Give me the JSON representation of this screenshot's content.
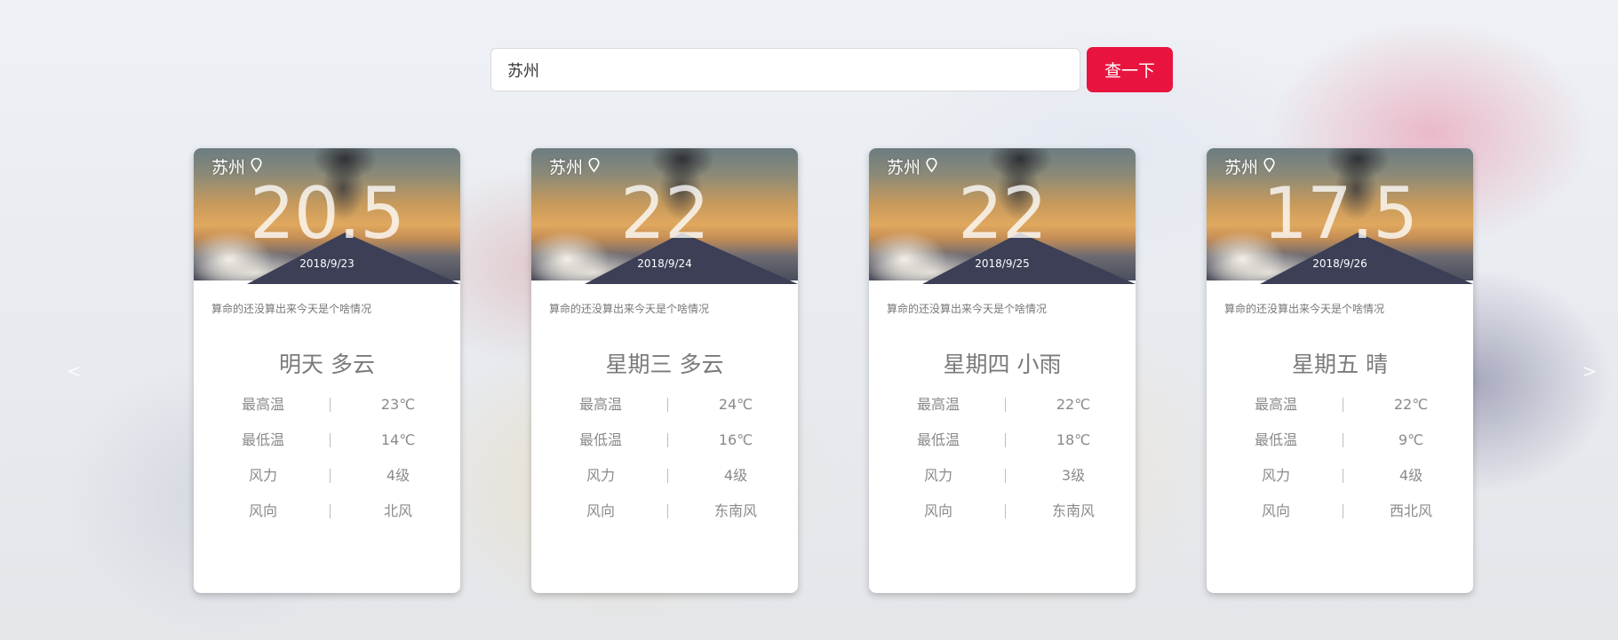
{
  "search": {
    "value": "苏州",
    "button_label": "查一下"
  },
  "carousel": {
    "prev_glyph": "<",
    "next_glyph": ">"
  },
  "cards": [
    {
      "city": "苏州",
      "temp": "20.5",
      "date": "2018/9/23",
      "note": "算命的还没算出来今天是个啥情况",
      "title": "明天 多云",
      "rows": [
        {
          "label": "最高温",
          "value": "23℃"
        },
        {
          "label": "最低温",
          "value": "14℃"
        },
        {
          "label": "风力",
          "value": "4级"
        },
        {
          "label": "风向",
          "value": "北风"
        }
      ]
    },
    {
      "city": "苏州",
      "temp": "22",
      "date": "2018/9/24",
      "note": "算命的还没算出来今天是个啥情况",
      "title": "星期三 多云",
      "rows": [
        {
          "label": "最高温",
          "value": "24℃"
        },
        {
          "label": "最低温",
          "value": "16℃"
        },
        {
          "label": "风力",
          "value": "4级"
        },
        {
          "label": "风向",
          "value": "东南风"
        }
      ]
    },
    {
      "city": "苏州",
      "temp": "22",
      "date": "2018/9/25",
      "note": "算命的还没算出来今天是个啥情况",
      "title": "星期四 小雨",
      "rows": [
        {
          "label": "最高温",
          "value": "22℃"
        },
        {
          "label": "最低温",
          "value": "18℃"
        },
        {
          "label": "风力",
          "value": "3级"
        },
        {
          "label": "风向",
          "value": "东南风"
        }
      ]
    },
    {
      "city": "苏州",
      "temp": "17.5",
      "date": "2018/9/26",
      "note": "算命的还没算出来今天是个啥情况",
      "title": "星期五 晴",
      "rows": [
        {
          "label": "最高温",
          "value": "22℃"
        },
        {
          "label": "最低温",
          "value": "9℃"
        },
        {
          "label": "风力",
          "value": "4级"
        },
        {
          "label": "风向",
          "value": "西北风"
        }
      ]
    }
  ],
  "icons": {
    "location": "location-pin-icon",
    "prev": "chevron-left-icon",
    "next": "chevron-right-icon"
  },
  "colors": {
    "accent": "#e8143f",
    "text_muted": "#8a8a8a"
  }
}
